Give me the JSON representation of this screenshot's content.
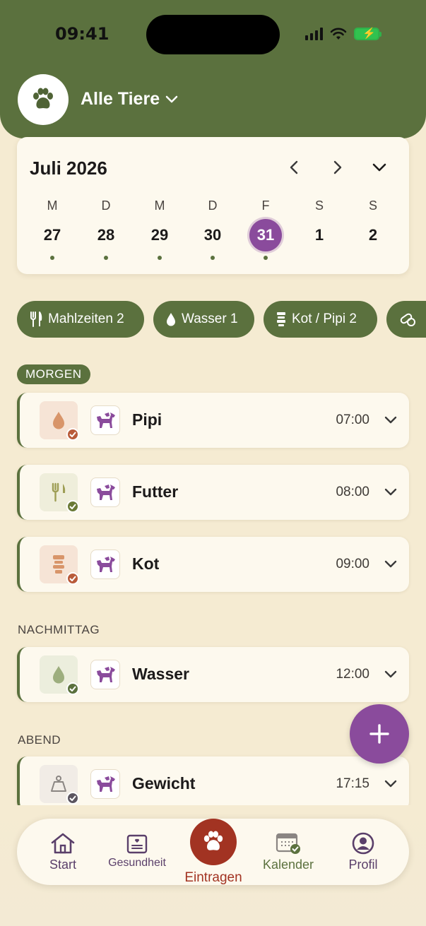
{
  "status_bar": {
    "time": "09:41"
  },
  "header": {
    "pet_selector": "Alle Tiere"
  },
  "calendar": {
    "month": "Juli 2026",
    "days": [
      {
        "letter": "M",
        "num": "27"
      },
      {
        "letter": "D",
        "num": "28"
      },
      {
        "letter": "M",
        "num": "29"
      },
      {
        "letter": "D",
        "num": "30"
      },
      {
        "letter": "F",
        "num": "31"
      },
      {
        "letter": "S",
        "num": "1"
      },
      {
        "letter": "S",
        "num": "2"
      }
    ]
  },
  "chips": [
    {
      "label": "Mahlzeiten 2",
      "icon": "fork-knife-icon"
    },
    {
      "label": "Wasser 1",
      "icon": "water-drop-icon"
    },
    {
      "label": "Kot / Pipi 2",
      "icon": "toilet-icon"
    },
    {
      "label": "",
      "icon": "pill-icon"
    }
  ],
  "sections": {
    "morning": "MORGEN",
    "afternoon": "NACHMITTAG",
    "evening": "ABEND"
  },
  "entries": [
    {
      "title": "Pipi",
      "time": "07:00",
      "icon": "drop-icon"
    },
    {
      "title": "Futter",
      "time": "08:00",
      "icon": "fork-knife-icon"
    },
    {
      "title": "Kot",
      "time": "09:00",
      "icon": "toilet-icon"
    },
    {
      "title": "Wasser",
      "time": "12:00",
      "icon": "drop-icon"
    },
    {
      "title": "Gewicht",
      "time": "17:15",
      "icon": "scale-icon"
    }
  ],
  "tabbar": {
    "start": "Start",
    "health": "Gesundheit",
    "entries": "Eintragen",
    "calendar": "Kalender",
    "profile": "Profil"
  },
  "colors": {
    "brand_green": "#5b713e",
    "accent_purple": "#8a4b9c",
    "accent_red": "#a23322",
    "background": "#f5ebd2"
  }
}
